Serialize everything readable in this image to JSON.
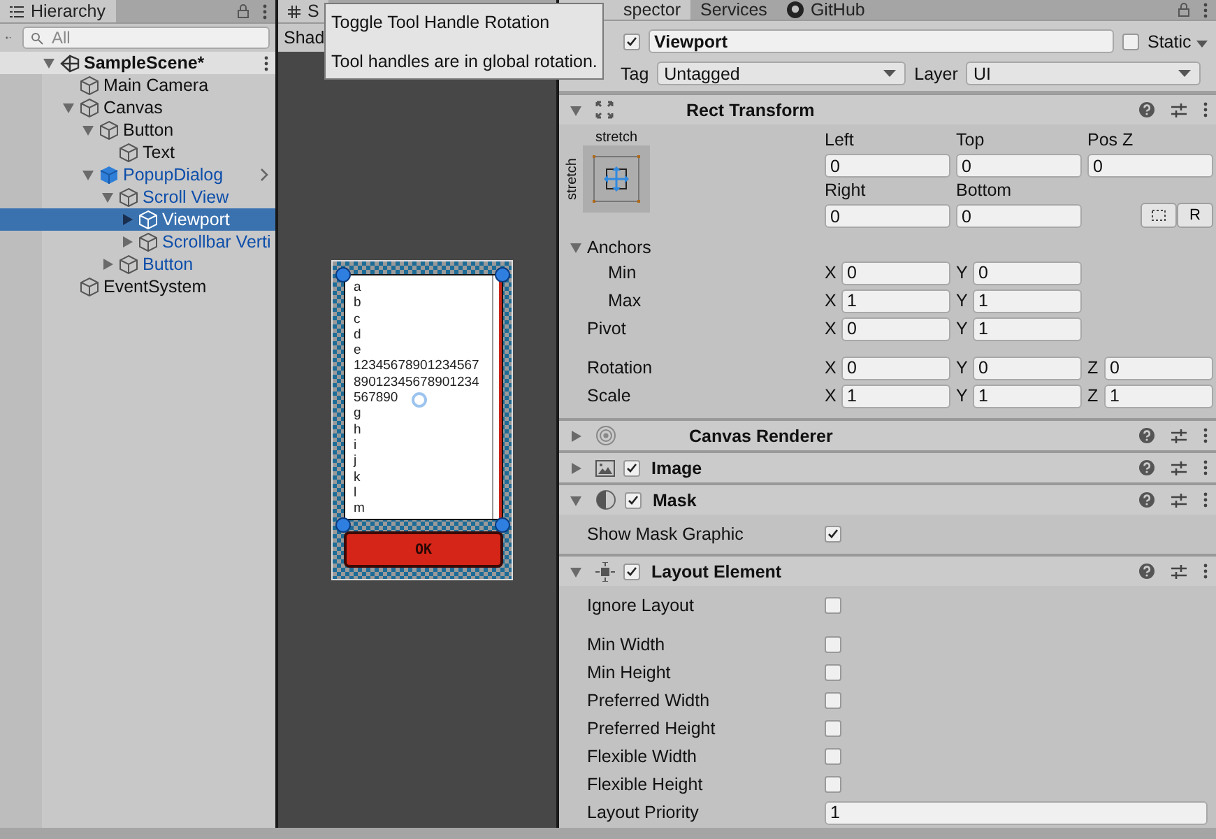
{
  "hierarchy": {
    "tab": "Hierarchy",
    "search": {
      "placeholder": "All"
    },
    "items": [
      {
        "name": "SampleScene*",
        "kind": "scene",
        "expanded": true,
        "selected": false,
        "children": [
          {
            "name": "Main Camera",
            "kind": "object",
            "prefab": false,
            "selected": false
          },
          {
            "name": "Canvas",
            "kind": "object",
            "prefab": false,
            "expanded": true,
            "selected": false,
            "children": [
              {
                "name": "Button",
                "kind": "object",
                "prefab": false,
                "expanded": true,
                "selected": false,
                "children": [
                  {
                    "name": "Text",
                    "kind": "object",
                    "prefab": false,
                    "selected": false
                  }
                ]
              },
              {
                "name": "PopupDialog",
                "kind": "prefab_root",
                "prefab": true,
                "expanded": true,
                "selected": false,
                "children": [
                  {
                    "name": "Scroll View",
                    "kind": "object",
                    "prefab": true,
                    "expanded": true,
                    "selected": false,
                    "children": [
                      {
                        "name": "Viewport",
                        "kind": "object",
                        "prefab": true,
                        "expanded": false,
                        "selected": true
                      },
                      {
                        "name": "Scrollbar Verti",
                        "kind": "object",
                        "prefab": true,
                        "expanded": false,
                        "selected": false
                      }
                    ]
                  },
                  {
                    "name": "Button",
                    "kind": "object",
                    "prefab": true,
                    "expanded": false,
                    "selected": false
                  }
                ]
              }
            ]
          },
          {
            "name": "EventSystem",
            "kind": "object",
            "prefab": false,
            "selected": false
          }
        ]
      }
    ]
  },
  "scene": {
    "tab": "S",
    "toolbar_label": "Shad",
    "popup": {
      "lines": [
        "a",
        "b",
        "c",
        "d",
        "e",
        "12345678901234567",
        "89012345678901234",
        "567890",
        "g",
        "h",
        "i",
        "j",
        "k",
        "l",
        "m"
      ],
      "button": "OK"
    }
  },
  "tooltip": {
    "title": "Toggle Tool Handle Rotation",
    "body": "Tool handles are in global rotation."
  },
  "inspector": {
    "tabs": [
      {
        "label": "spector",
        "selected": true
      },
      {
        "label": "Services",
        "selected": false
      },
      {
        "label": "GitHub",
        "selected": false,
        "kind": "github"
      }
    ],
    "object": {
      "active": true,
      "name": "Viewport",
      "static": false,
      "static_label": "Static",
      "tag_label": "Tag",
      "tag": "Untagged",
      "layer_label": "Layer",
      "layer": "UI"
    },
    "components": [
      {
        "kind": "rect_transform",
        "name": "Rect Transform",
        "expanded": true,
        "rect": {
          "preset_top": "stretch",
          "preset_side": "stretch",
          "field_rows": [
            {
              "fields": [
                {
                  "label": "Left",
                  "value": "0"
                },
                {
                  "label": "Top",
                  "value": "0"
                },
                {
                  "label": "Pos Z",
                  "value": "0"
                }
              ]
            },
            {
              "fields": [
                {
                  "label": "Right",
                  "value": "0"
                },
                {
                  "label": "Bottom",
                  "value": "0"
                }
              ],
              "raw_button": "R"
            }
          ],
          "anchors": {
            "label": "Anchors",
            "expanded": true,
            "rows": [
              {
                "label": "Min",
                "axes": [
                  {
                    "axis": "X",
                    "value": "0"
                  },
                  {
                    "axis": "Y",
                    "value": "0"
                  }
                ]
              },
              {
                "label": "Max",
                "axes": [
                  {
                    "axis": "X",
                    "value": "1"
                  },
                  {
                    "axis": "Y",
                    "value": "1"
                  }
                ]
              }
            ]
          },
          "rows": [
            {
              "label": "Pivot",
              "axes": [
                {
                  "axis": "X",
                  "value": "0"
                },
                {
                  "axis": "Y",
                  "value": "1"
                }
              ]
            },
            {
              "label": "Rotation",
              "axes": [
                {
                  "axis": "X",
                  "value": "0"
                },
                {
                  "axis": "Y",
                  "value": "0"
                },
                {
                  "axis": "Z",
                  "value": "0"
                }
              ]
            },
            {
              "label": "Scale",
              "axes": [
                {
                  "axis": "X",
                  "value": "1"
                },
                {
                  "axis": "Y",
                  "value": "1"
                },
                {
                  "axis": "Z",
                  "value": "1"
                }
              ]
            }
          ]
        }
      },
      {
        "kind": "canvas_renderer",
        "name": "Canvas Renderer",
        "expanded": false
      },
      {
        "kind": "image",
        "name": "Image",
        "expanded": false,
        "enabled": true
      },
      {
        "kind": "mask",
        "name": "Mask",
        "expanded": true,
        "enabled": true,
        "properties": [
          {
            "label": "Show Mask Graphic",
            "kind": "checkbox",
            "checked": true
          }
        ]
      },
      {
        "kind": "layout_element",
        "name": "Layout Element",
        "expanded": true,
        "enabled": true,
        "properties": [
          {
            "label": "Ignore Layout",
            "kind": "checkbox",
            "checked": false
          },
          {
            "label": "Min Width",
            "kind": "checkbox",
            "checked": false
          },
          {
            "label": "Min Height",
            "kind": "checkbox",
            "checked": false
          },
          {
            "label": "Preferred Width",
            "kind": "checkbox",
            "checked": false
          },
          {
            "label": "Preferred Height",
            "kind": "checkbox",
            "checked": false
          },
          {
            "label": "Flexible Width",
            "kind": "checkbox",
            "checked": false
          },
          {
            "label": "Flexible Height",
            "kind": "checkbox",
            "checked": false
          },
          {
            "label": "Layout Priority",
            "kind": "number",
            "value": "1"
          }
        ]
      }
    ]
  }
}
